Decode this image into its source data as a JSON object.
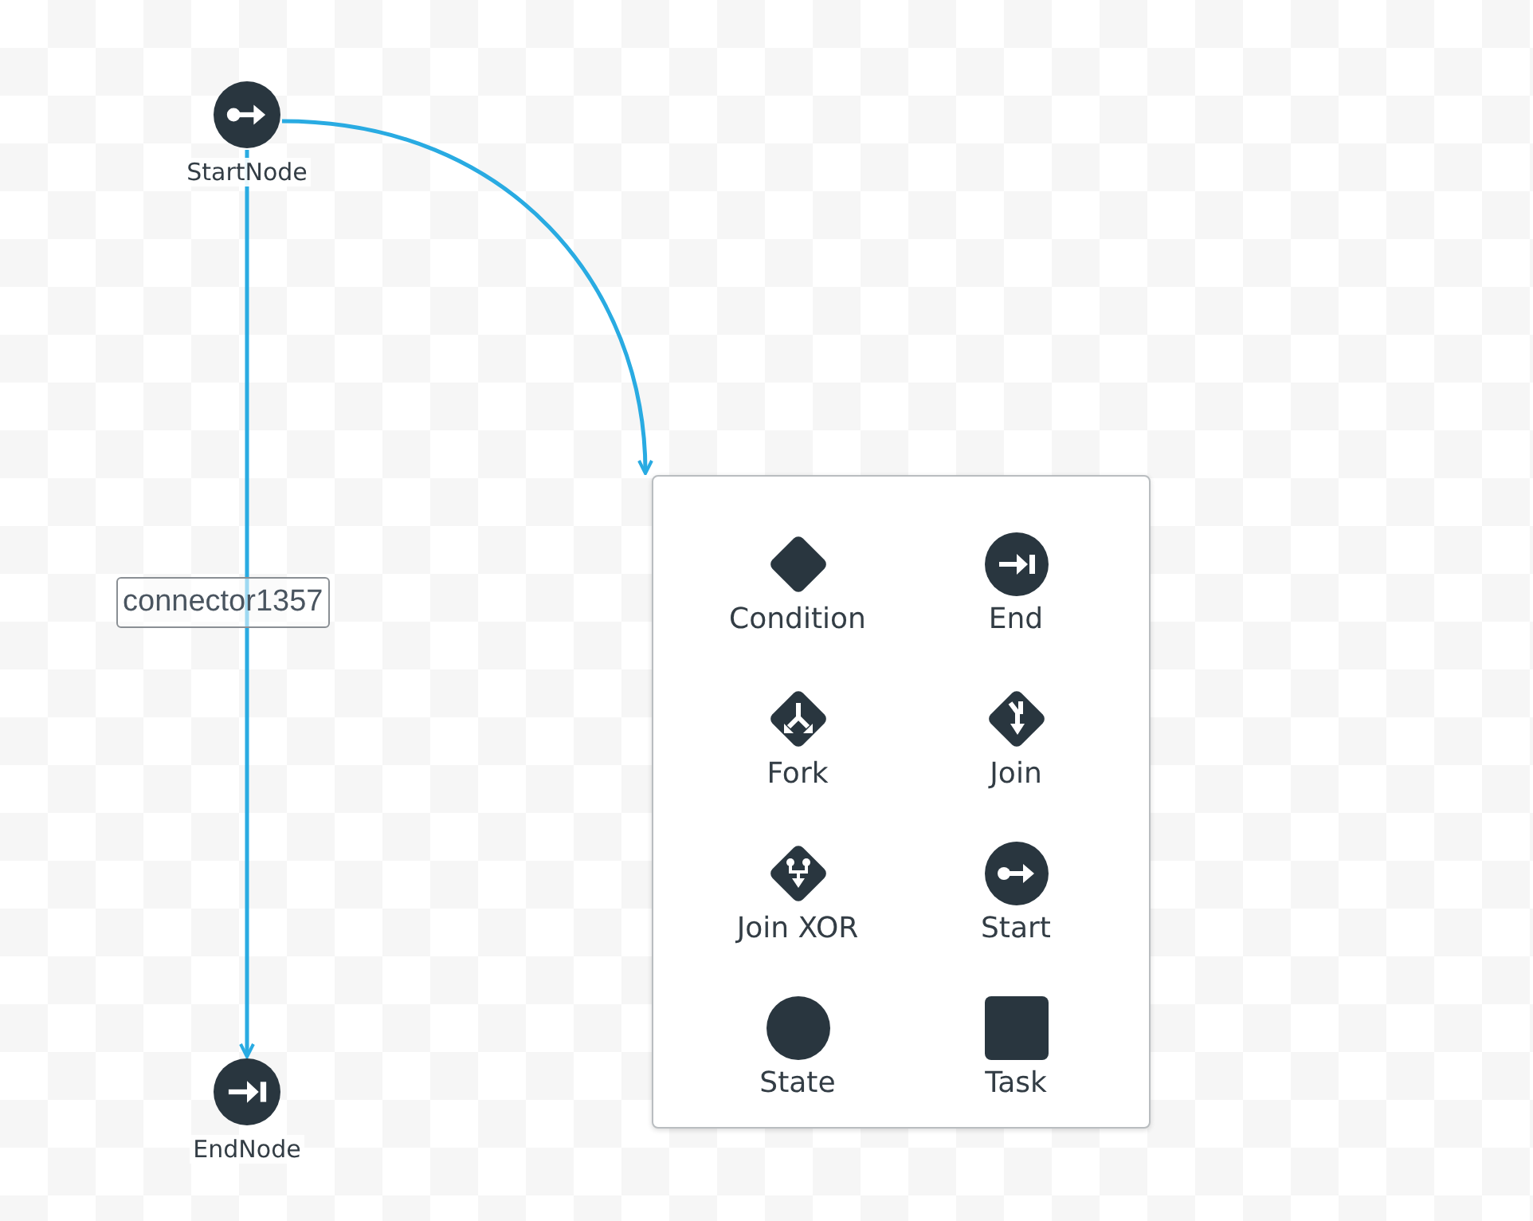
{
  "nodes": [
    {
      "label": "StartNode",
      "kind": "start"
    },
    {
      "label": "EndNode",
      "kind": "end"
    }
  ],
  "connectors": [
    {
      "label": "connector1357",
      "kind": "straight"
    },
    {
      "kind": "curve"
    }
  ],
  "palette": {
    "items": [
      {
        "label": "Condition",
        "kind": "condition"
      },
      {
        "label": "End",
        "kind": "end"
      },
      {
        "label": "Fork",
        "kind": "fork"
      },
      {
        "label": "Join",
        "kind": "join"
      },
      {
        "label": "Join XOR",
        "kind": "joinxor"
      },
      {
        "label": "Start",
        "kind": "start"
      },
      {
        "label": "State",
        "kind": "state"
      },
      {
        "label": "Task",
        "kind": "task"
      }
    ]
  }
}
